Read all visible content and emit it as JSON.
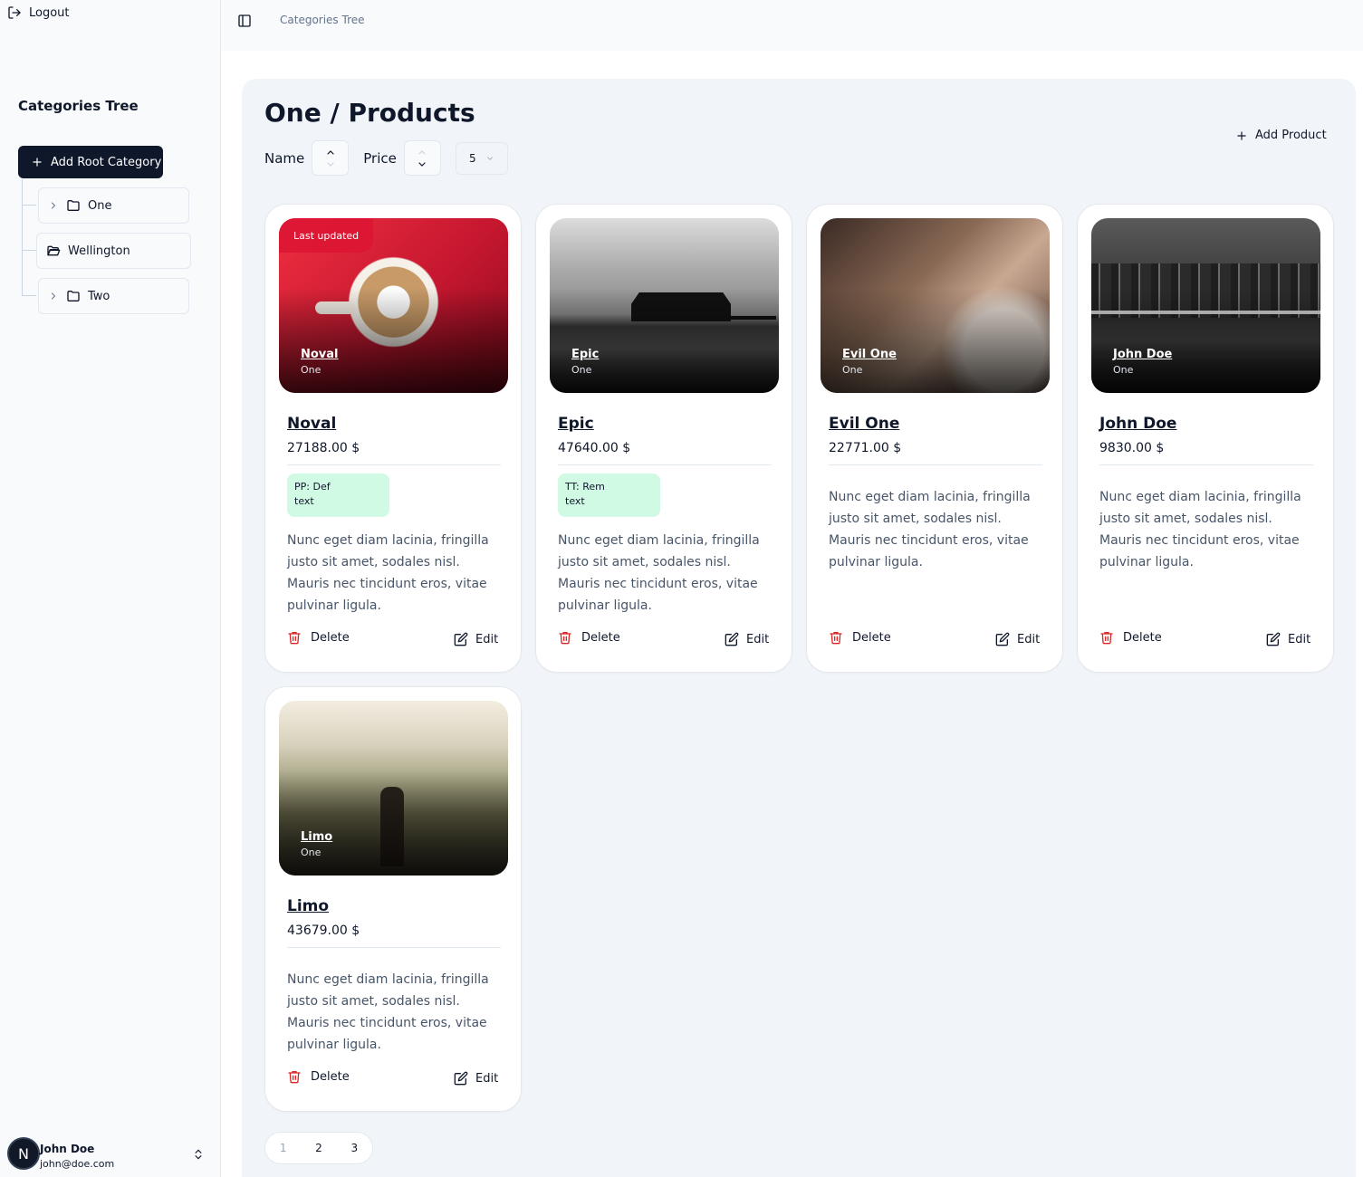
{
  "sidebar": {
    "logout_label": "Logout",
    "title": "Categories Tree",
    "add_root_label": "Add Root Category",
    "tree": [
      {
        "label": "One",
        "expandable": true
      },
      {
        "label": "Wellington",
        "expandable": false
      },
      {
        "label": "Two",
        "expandable": true
      }
    ],
    "user": {
      "avatar_letter": "N",
      "name": "John Doe",
      "email": "john@doe.com"
    }
  },
  "header": {
    "breadcrumb": "Categories Tree"
  },
  "main": {
    "title": "One / Products",
    "sort": {
      "name_label": "Name",
      "price_label": "Price",
      "page_size": "5"
    },
    "add_product_label": "Add Product",
    "cards": [
      {
        "name": "Noval",
        "category": "One",
        "price": "27188.00 $",
        "badge": "Last updated",
        "tag_line1": "PP: Def",
        "tag_line2": "text",
        "description": "Nunc eget diam lacinia, fringilla justo sit amet, sodales nisl. Mauris nec tincidunt eros, vitae pulvinar ligula.",
        "delete_label": "Delete",
        "edit_label": "Edit",
        "image": "coffee-cup-photo"
      },
      {
        "name": "Epic",
        "category": "One",
        "price": "47640.00 $",
        "badge": "",
        "tag_line1": "TT: Rem",
        "tag_line2": "text",
        "description": "Nunc eget diam lacinia, fringilla justo sit amet, sodales nisl. Mauris nec tincidunt eros, vitae pulvinar ligula.",
        "delete_label": "Delete",
        "edit_label": "Edit",
        "image": "pier-photo"
      },
      {
        "name": "Evil One",
        "category": "One",
        "price": "22771.00 $",
        "badge": "",
        "tag_line1": "",
        "tag_line2": "",
        "description": "Nunc eget diam lacinia, fringilla justo sit amet, sodales nisl. Mauris nec tincidunt eros, vitae pulvinar ligula.",
        "delete_label": "Delete",
        "edit_label": "Edit",
        "image": "baseball-glove-photo"
      },
      {
        "name": "John Doe",
        "category": "One",
        "price": "9830.00 $",
        "badge": "",
        "tag_line1": "",
        "tag_line2": "",
        "description": "Nunc eget diam lacinia, fringilla justo sit amet, sodales nisl. Mauris nec tincidunt eros, vitae pulvinar ligula.",
        "delete_label": "Delete",
        "edit_label": "Edit",
        "image": "city-bridge-photo"
      },
      {
        "name": "Limo",
        "category": "One",
        "price": "43679.00 $",
        "badge": "",
        "tag_line1": "",
        "tag_line2": "",
        "description": "Nunc eget diam lacinia, fringilla justo sit amet, sodales nisl. Mauris nec tincidunt eros, vitae pulvinar ligula.",
        "delete_label": "Delete",
        "edit_label": "Edit",
        "image": "mountain-hiker-photo"
      }
    ],
    "pagination": [
      "1",
      "2",
      "3"
    ]
  },
  "colors": {
    "primary": "#0f172a",
    "danger": "#dc2626",
    "tag_bg": "#d1fae5",
    "panel_bg": "#f1f5f9"
  }
}
